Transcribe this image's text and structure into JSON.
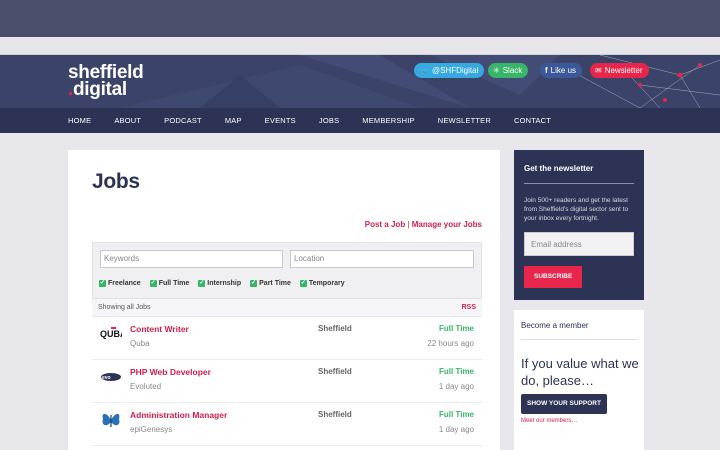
{
  "header": {
    "logo_line1": "sheffield",
    "logo_line2": "digital",
    "social": {
      "twitter": "@SHFDigital",
      "slack": "Slack",
      "facebook": "Like us",
      "newsletter": "Newsletter"
    }
  },
  "nav": {
    "items": [
      "HOME",
      "ABOUT",
      "PODCAST",
      "MAP",
      "EVENTS",
      "JOBS",
      "MEMBERSHIP",
      "NEWSLETTER",
      "CONTACT"
    ]
  },
  "main": {
    "title": "Jobs",
    "post_job": "Post a Job",
    "separator": "|",
    "manage_jobs": "Manage your Jobs",
    "filters": {
      "keywords_placeholder": "Keywords",
      "location_placeholder": "Location",
      "types": [
        "Freelance",
        "Full Time",
        "Internship",
        "Part Time",
        "Temporary"
      ]
    },
    "showing": "Showing all Jobs",
    "rss": "RSS",
    "jobs": [
      {
        "title": "Content Writer",
        "company": "Quba",
        "location": "Sheffield",
        "type": "Full Time",
        "posted": "22 hours ago",
        "logo": "quba-logo"
      },
      {
        "title": "PHP Web Developer",
        "company": "Evoluted",
        "location": "Sheffield",
        "type": "Full Time",
        "posted": "1 day ago",
        "logo": "evoluted-logo"
      },
      {
        "title": "Administration Manager",
        "company": "epiGenesys",
        "location": "Sheffield",
        "type": "Full Time",
        "posted": "1 day ago",
        "logo": "epigenesys-logo"
      }
    ]
  },
  "sidebar": {
    "newsletter": {
      "title": "Get the newsletter",
      "text": "Join 500+ readers and get the latest from Sheffield's digital sector sent to your inbox every fortnight.",
      "email_placeholder": "Email address",
      "subscribe": "SUBSCRIBE"
    },
    "member": {
      "title": "Become a member",
      "headline": "If you value what we do, please…",
      "button": "SHOW YOUR SUPPORT",
      "link": "Meet our members…"
    }
  },
  "colors": {
    "navy": "#2c3354",
    "accent": "#e8254a",
    "green": "#39b56a"
  }
}
